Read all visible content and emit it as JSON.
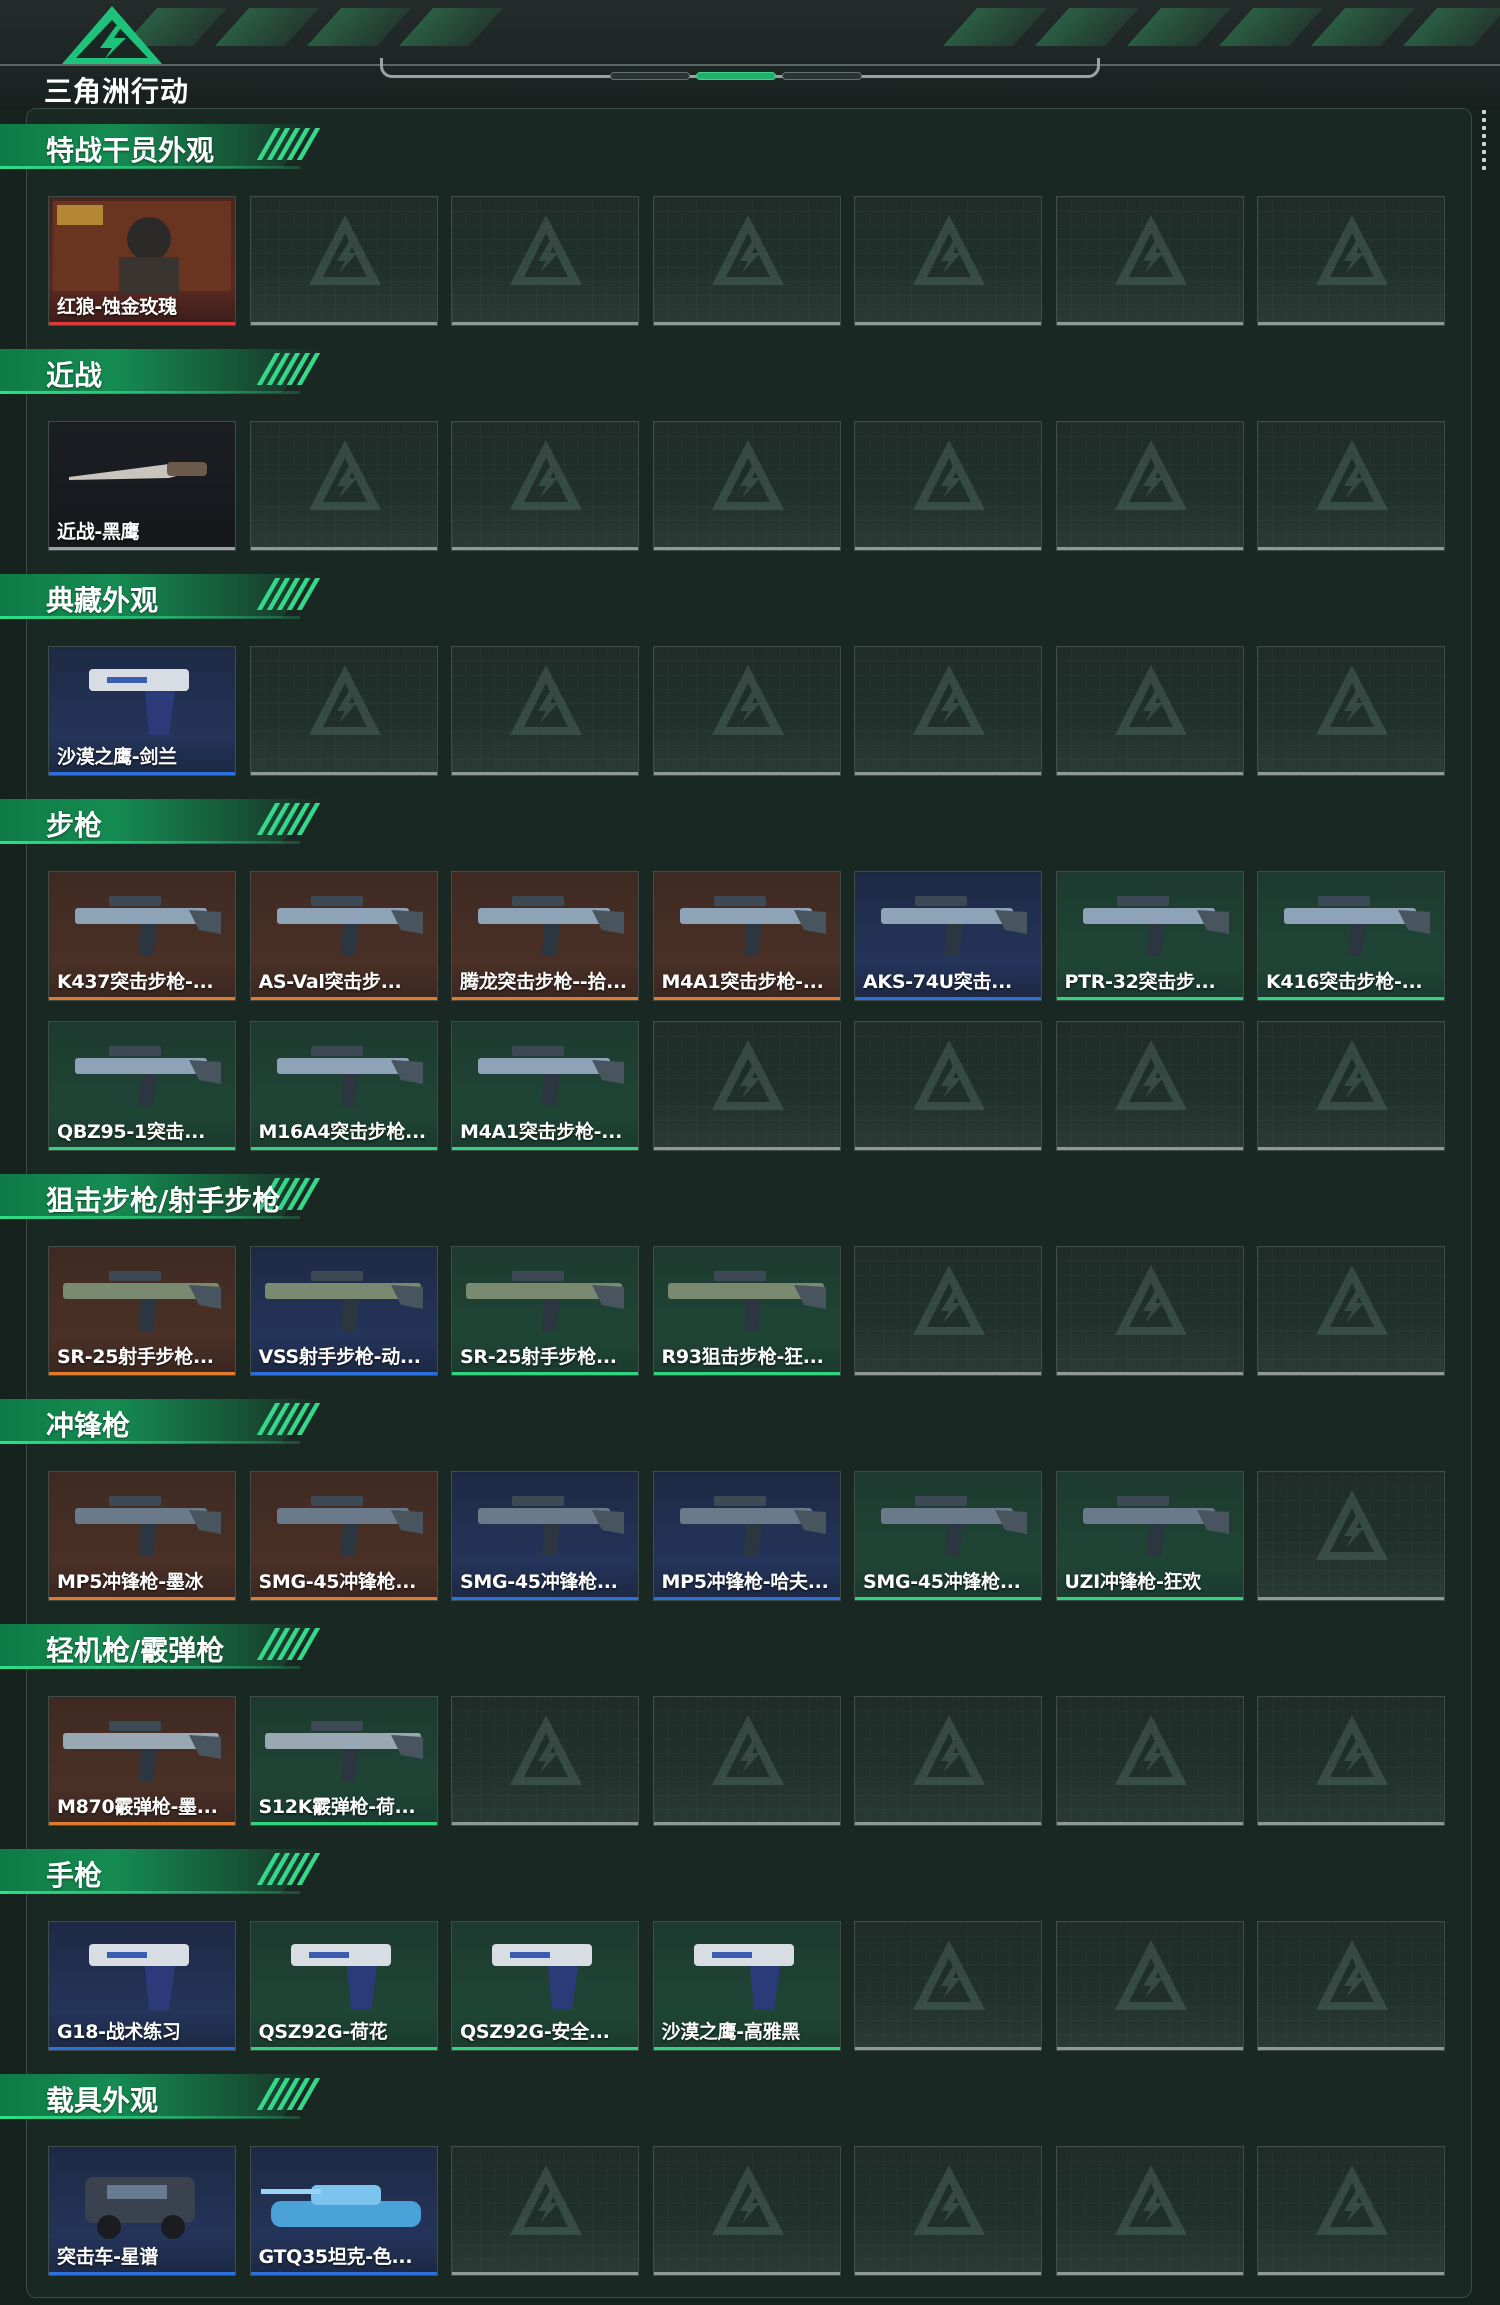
{
  "header": {
    "logo_title": "三角洲行动"
  },
  "colors": {
    "accent": "#1fb06a",
    "rarity_red": "#d93b3b",
    "rarity_orange": "#e07a2e",
    "rarity_blue": "#2e6fe0",
    "rarity_green": "#2fd47e",
    "empty_slot": "#8f9997"
  },
  "sections": [
    {
      "title": "特战干员外观",
      "rows": [
        [
          {
            "label": "红狼-蚀金玫瑰",
            "rarity": "red",
            "icon": "operator-portrait-icon"
          },
          null,
          null,
          null,
          null,
          null,
          null
        ]
      ]
    },
    {
      "title": "近战",
      "rows": [
        [
          {
            "label": "近战-黑鹰",
            "rarity": "dark",
            "icon": "knife-icon"
          },
          null,
          null,
          null,
          null,
          null,
          null
        ]
      ]
    },
    {
      "title": "典藏外观",
      "rows": [
        [
          {
            "label": "沙漠之鹰-剑兰",
            "rarity": "blue",
            "icon": "pistol-icon"
          },
          null,
          null,
          null,
          null,
          null,
          null
        ]
      ]
    },
    {
      "title": "步枪",
      "rows": [
        [
          {
            "label": "K437突击步枪-...",
            "rarity": "orange",
            "icon": "rifle-icon"
          },
          {
            "label": "AS-Val突击步...",
            "rarity": "orange",
            "icon": "rifle-icon"
          },
          {
            "label": "腾龙突击步枪--拾...",
            "rarity": "orange",
            "icon": "rifle-icon"
          },
          {
            "label": "M4A1突击步枪-...",
            "rarity": "orange",
            "icon": "rifle-icon"
          },
          {
            "label": "AKS-74U突击...",
            "rarity": "blue",
            "icon": "rifle-icon"
          },
          {
            "label": "PTR-32突击步...",
            "rarity": "green",
            "icon": "rifle-icon"
          },
          {
            "label": "K416突击步枪-...",
            "rarity": "green",
            "icon": "rifle-icon"
          }
        ],
        [
          {
            "label": "QBZ95-1突击...",
            "rarity": "green",
            "icon": "rifle-icon"
          },
          {
            "label": "M16A4突击步枪...",
            "rarity": "green",
            "icon": "rifle-icon"
          },
          {
            "label": "M4A1突击步枪-...",
            "rarity": "green",
            "icon": "rifle-icon"
          },
          null,
          null,
          null,
          null
        ]
      ]
    },
    {
      "title": "狙击步枪/射手步枪",
      "rows": [
        [
          {
            "label": "SR-25射手步枪...",
            "rarity": "orange",
            "icon": "sniper-icon"
          },
          {
            "label": "VSS射手步枪-动...",
            "rarity": "blue",
            "icon": "sniper-icon"
          },
          {
            "label": "SR-25射手步枪...",
            "rarity": "green",
            "icon": "sniper-icon"
          },
          {
            "label": "R93狙击步枪-狂...",
            "rarity": "green",
            "icon": "sniper-icon"
          },
          null,
          null,
          null
        ]
      ]
    },
    {
      "title": "冲锋枪",
      "rows": [
        [
          {
            "label": "MP5冲锋枪-墨冰",
            "rarity": "orange",
            "icon": "smg-icon"
          },
          {
            "label": "SMG-45冲锋枪...",
            "rarity": "orange",
            "icon": "smg-icon"
          },
          {
            "label": "SMG-45冲锋枪...",
            "rarity": "blue",
            "icon": "smg-icon"
          },
          {
            "label": "MP5冲锋枪-哈夫...",
            "rarity": "blue",
            "icon": "smg-icon"
          },
          {
            "label": "SMG-45冲锋枪...",
            "rarity": "green",
            "icon": "smg-icon"
          },
          {
            "label": "UZI冲锋枪-狂欢",
            "rarity": "green",
            "icon": "smg-icon"
          },
          null
        ]
      ]
    },
    {
      "title": "轻机枪/霰弹枪",
      "rows": [
        [
          {
            "label": "M870霰弹枪-墨...",
            "rarity": "orange",
            "icon": "shotgun-icon"
          },
          {
            "label": "S12K霰弹枪-荷...",
            "rarity": "green",
            "icon": "shotgun-icon"
          },
          null,
          null,
          null,
          null,
          null
        ]
      ]
    },
    {
      "title": "手枪",
      "rows": [
        [
          {
            "label": "G18-战术练习",
            "rarity": "blue",
            "icon": "pistol-icon"
          },
          {
            "label": "QSZ92G-荷花",
            "rarity": "green",
            "icon": "pistol-icon"
          },
          {
            "label": "QSZ92G-安全...",
            "rarity": "green",
            "icon": "pistol-icon"
          },
          {
            "label": "沙漠之鹰-高雅黑",
            "rarity": "green",
            "icon": "pistol-icon"
          },
          null,
          null,
          null
        ]
      ]
    },
    {
      "title": "载具外观",
      "rows": [
        [
          {
            "label": "突击车-星谱",
            "rarity": "blue",
            "icon": "vehicle-icon"
          },
          {
            "label": "GTQ35坦克-色...",
            "rarity": "blue",
            "icon": "tank-icon"
          },
          null,
          null,
          null,
          null,
          null
        ]
      ]
    }
  ]
}
